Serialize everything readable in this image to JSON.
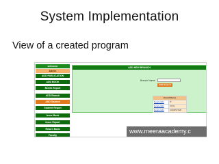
{
  "slide": {
    "title": "System Implementation",
    "subtitle": "View of a created program"
  },
  "app": {
    "sidebar": {
      "welcome": "welcome",
      "items": [
        "Admin",
        "ADD PUBLICATION",
        "ADD BOOK",
        "BOOK Report",
        "ADD Branch",
        "ADD Student",
        "Student Report",
        "Issue Book",
        "Issue Report",
        "Return Book",
        "Faculty"
      ]
    },
    "panel": {
      "header": "ADD NEW BRANCH",
      "branch_label": "Branch Name:",
      "branch_value": "",
      "add_button": "ADD Branch",
      "table_header": "BranchName",
      "rows": [
        {
          "delete": "Delete",
          "edit": "Edit",
          "name": "IT"
        },
        {
          "delete": "Delete",
          "edit": "Edit",
          "name": "CIVIL"
        },
        {
          "delete": "Delete",
          "edit": "Edit",
          "name": "COMPUTER"
        }
      ]
    }
  },
  "watermark": "www.meeraacademy.c",
  "colors": {
    "sidebar_green": "#0e6b0e",
    "active_orange": "#e07a1e",
    "panel_green": "#ccf2cc",
    "table_header": "#f0c28a"
  }
}
